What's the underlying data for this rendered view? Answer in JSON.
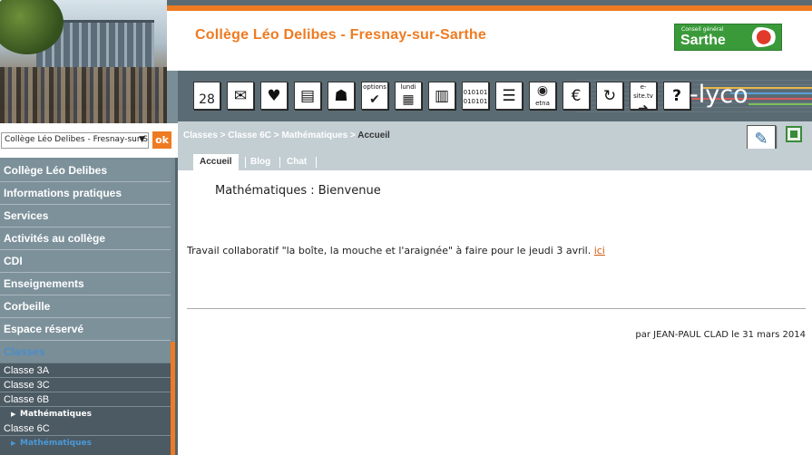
{
  "header": {
    "site_title": "Collège Léo Delibes - Fresnay-sur-Sarthe",
    "partner_small": "Conseil général",
    "partner_big": "Sarthe",
    "lyco_label": "-lyco"
  },
  "site_select": {
    "value": "Collège Léo Delibes - Fresnay-sur-Sarthe",
    "ok_label": "ok"
  },
  "menu": {
    "items": [
      "Collège Léo Delibes",
      "Informations pratiques",
      "Services",
      "Activités au collège",
      "CDI",
      "Enseignements",
      "Corbeille",
      "Espace réservé",
      "Classes"
    ],
    "classes": {
      "c3a": "Classe 3A",
      "c3c": "Classe 3C",
      "c6b": "Classe 6B",
      "c6b_sub": "Mathématiques",
      "c6c": "Classe 6C",
      "c6c_sub": "Mathématiques"
    }
  },
  "toolbar": {
    "calendar": "28",
    "options": "options",
    "lundi": "lundi",
    "binary": "010101",
    "etna": "etna",
    "esite": "e-site.tv",
    "help": "?"
  },
  "breadcrumb": {
    "classes": "Classes",
    "sep1": " > ",
    "classe": "Classe 6C",
    "sep2": " > ",
    "matiere": "Mathématiques",
    "sep3": " > ",
    "current": "Accueil"
  },
  "tabs": {
    "accueil": "Accueil",
    "blog": "Blog",
    "chat": "Chat"
  },
  "content": {
    "title": "Mathématiques : Bienvenue",
    "text": "Travail collaboratif  \"la boîte, la mouche et l'araignée\" à faire pour le jeudi 3 avril. ",
    "link": "ici",
    "byline": "par JEAN-PAUL CLAD le 31 mars 2014"
  },
  "colors": {
    "accent": "#ee7b22",
    "sidebar": "#7d919b",
    "toolbar": "#5b6b74",
    "crumbbar": "#c3ced3"
  }
}
